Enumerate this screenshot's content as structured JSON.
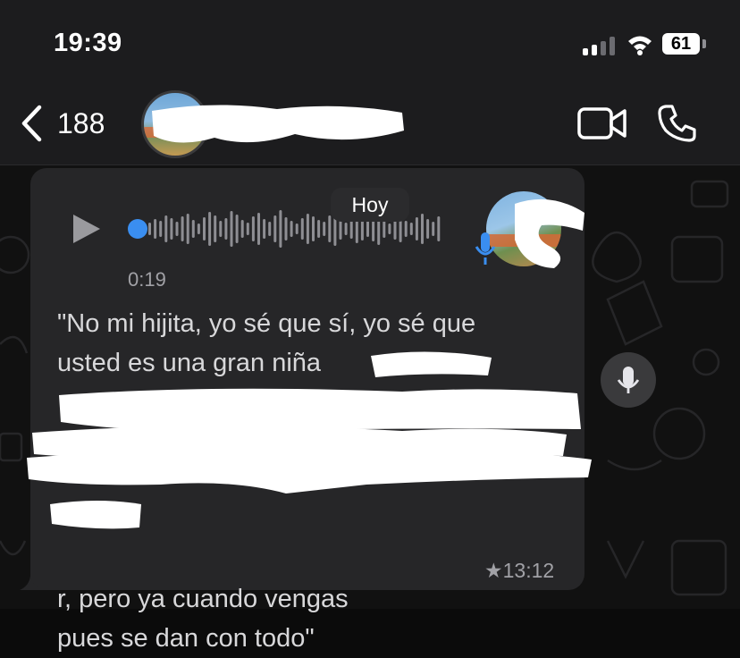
{
  "status_bar": {
    "time": "19:39",
    "battery": "61",
    "icons": [
      "signal-icon",
      "wifi-icon",
      "battery-icon"
    ]
  },
  "nav_bar": {
    "back_count": "188",
    "icons": [
      "chevron-left-icon",
      "video-camera-icon",
      "phone-icon"
    ]
  },
  "chat": {
    "date_label": "Hoy",
    "message": {
      "type": "voice-note",
      "duration": "0:19",
      "transcript": "\"No mi hijita, yo sé que sí, yo sé que\nusted es una gran niña\n\n\n\n\n\n                         r, pero ya cuando vengas\npues se dan con todo\"",
      "time": "13:12",
      "starred": true
    }
  },
  "colors": {
    "accent": "#3a8ef0",
    "bubble": "#262628",
    "bar": "#1c1c1e"
  }
}
